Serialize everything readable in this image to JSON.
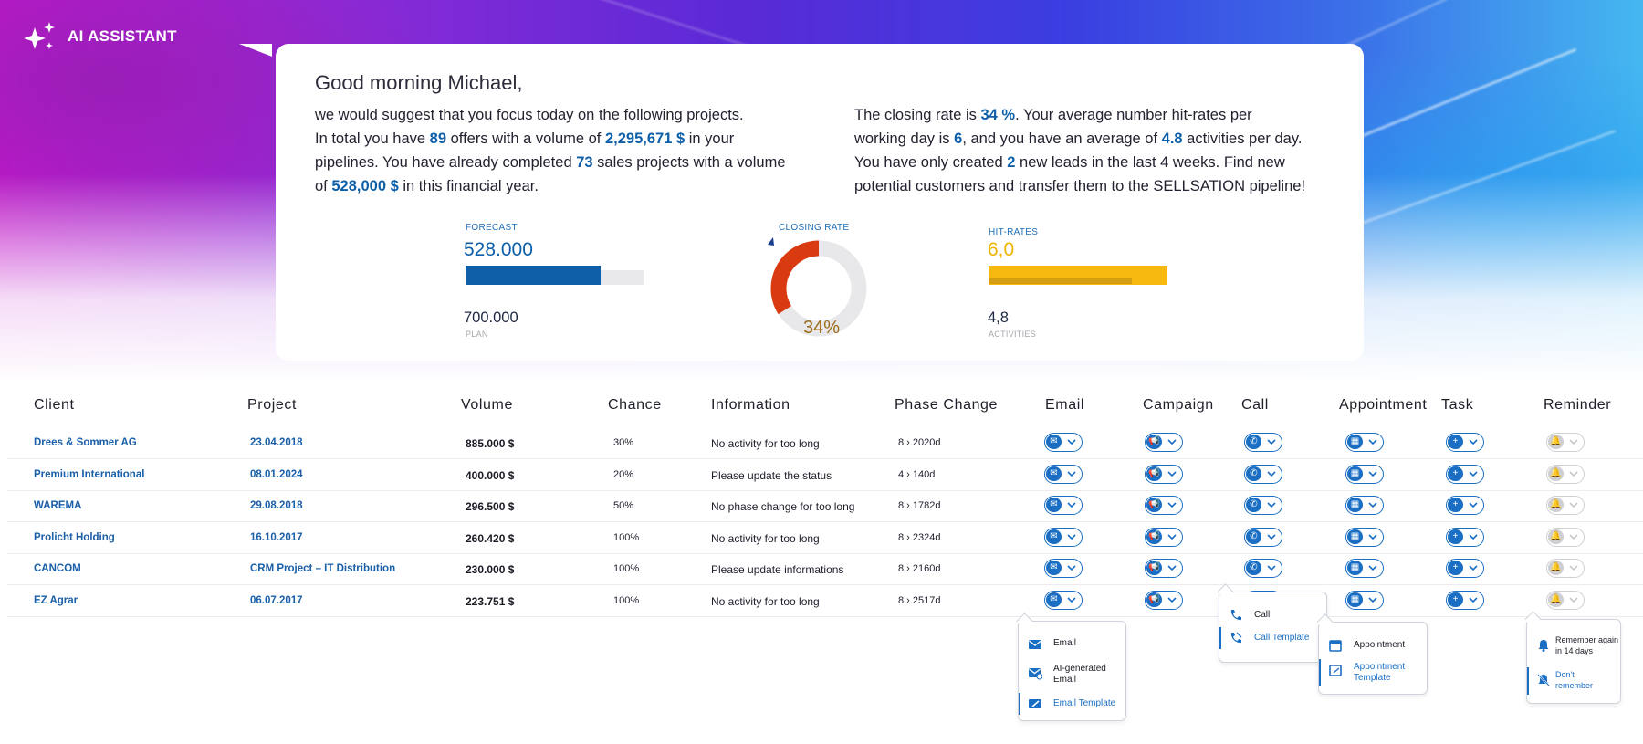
{
  "brand": {
    "name": "AI ASSISTANT"
  },
  "greeting": "Good morning Michael,",
  "summary_left": {
    "l1": "we would suggest that you focus today on the following projects.",
    "l2a": "In total you have ",
    "offers": "89",
    "l2b": " offers with a volume of ",
    "offers_volume": "2,295,671 $",
    "l2c": " in your",
    "l3a": "pipelines. You have already completed ",
    "completed": "73",
    "l3b": " sales projects with a volume",
    "l4a": "of ",
    "completed_volume": "528,000 $",
    "l4b": " in this financial year."
  },
  "summary_right": {
    "l1a": "The closing rate is ",
    "closing_rate": "34 %",
    "l1b": ". Your average number hit-rates per",
    "l2a": "working day is ",
    "hit_rate": "6",
    "l2b": ", and you have an average of ",
    "activities": "4.8",
    "l2c": " activities per day.",
    "l3a": "You have only created ",
    "new_leads": "2",
    "l3b": " new leads in the last 4 weeks. Find new",
    "l4": "potential customers and transfer them to the SELLSATION pipeline!"
  },
  "kpis": {
    "forecast": {
      "label": "FORECAST",
      "value": "528.000",
      "plan_value": "700.000",
      "plan_label": "PLAN",
      "fill_fraction": 0.754
    },
    "closing": {
      "label": "CLOSING RATE",
      "value": "34%",
      "fill_fraction": 0.34
    },
    "hits": {
      "label": "HIT-RATES",
      "value": "6,0",
      "activities_value": "4,8",
      "activities_label": "ACTIVITIES",
      "fill_fraction": 1.0,
      "activities_fraction": 0.8
    }
  },
  "colors": {
    "accent": "#0d5fa8",
    "forecast_bar": "#0f5ea8",
    "hits_bar": "#f7b90f",
    "closing_arc": "#d93a10",
    "closing_text": "#9a6a16"
  },
  "table": {
    "headers": [
      "Client",
      "Project",
      "Volume",
      "Chance",
      "Information",
      "Phase Change",
      "Email",
      "Campaign",
      "Call",
      "Appointment",
      "Task",
      "Reminder"
    ],
    "rows": [
      {
        "client": "Drees & Sommer AG",
        "project": "23.04.2018",
        "volume": "885.000 $",
        "chance": "30%",
        "info": "No activity for too long",
        "phase": "8 › 2020d"
      },
      {
        "client": "Premium International",
        "project": "08.01.2024",
        "volume": "400.000 $",
        "chance": "20%",
        "info": "Please update the status",
        "phase": "4 › 140d"
      },
      {
        "client": "WAREMA",
        "project": "29.08.2018",
        "volume": "296.500 $",
        "chance": "50%",
        "info": "No phase change for too long",
        "phase": "8 › 1782d"
      },
      {
        "client": "Prolicht Holding",
        "project": "16.10.2017",
        "volume": "260.420 $",
        "chance": "100%",
        "info": "No activity for too long",
        "phase": "8 › 2324d"
      },
      {
        "client": "CANCOM",
        "project": "CRM Project – IT Distribution",
        "volume": "230.000 $",
        "chance": "100%",
        "info": "Please update informations",
        "phase": "8 › 2160d"
      },
      {
        "client": "EZ Agrar",
        "project": "06.07.2017",
        "volume": "223.751 $",
        "chance": "100%",
        "info": "No activity for too long",
        "phase": "8 › 2517d"
      }
    ],
    "action_icons": [
      "envelope-icon",
      "megaphone-icon",
      "phone-icon",
      "calendar-icon",
      "plus-icon",
      "bell-icon"
    ]
  },
  "dropdowns": {
    "email": {
      "items": [
        "Email",
        "AI-generated Email",
        "Email Template"
      ],
      "active": "Email Template"
    },
    "call": {
      "items": [
        "Call",
        "Call Template"
      ],
      "active": "Call Template"
    },
    "appointment": {
      "items": [
        "Appointment",
        "Appointment Template"
      ],
      "active": "Appointment Template"
    },
    "reminder": {
      "items": [
        "Remember again in 14 days",
        "Don't remember"
      ],
      "active": "Don't remember"
    }
  }
}
